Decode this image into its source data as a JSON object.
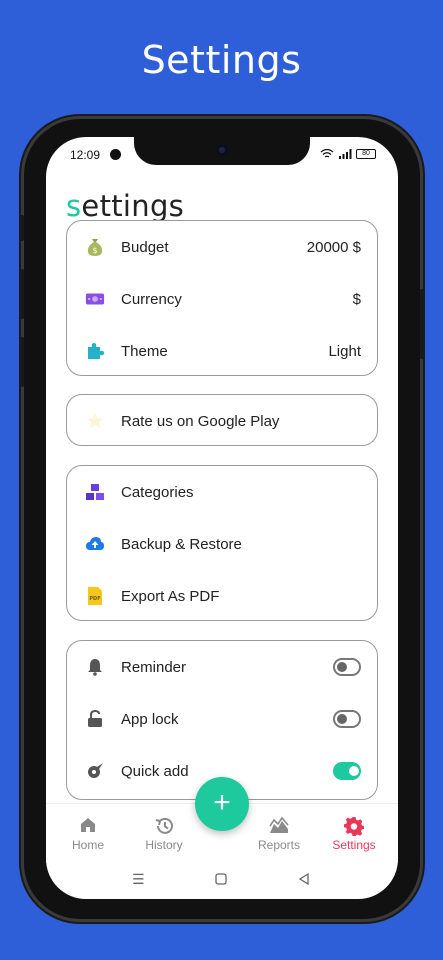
{
  "promo": {
    "title": "Settings"
  },
  "status": {
    "time": "12:09",
    "battery": "80"
  },
  "app": {
    "title_first": "s",
    "title_rest": "ettings"
  },
  "general": [
    {
      "icon": "money-bag-icon",
      "label": "Budget",
      "value": "20000 $"
    },
    {
      "icon": "banknote-icon",
      "label": "Currency",
      "value": "$"
    },
    {
      "icon": "puzzle-icon",
      "label": "Theme",
      "value": "Light"
    }
  ],
  "rate": {
    "label": "Rate us on Google Play"
  },
  "data_section": [
    {
      "icon": "cubes-icon",
      "label": "Categories"
    },
    {
      "icon": "cloud-upload-icon",
      "label": "Backup & Restore"
    },
    {
      "icon": "pdf-file-icon",
      "label": "Export As PDF"
    }
  ],
  "toggles": [
    {
      "icon": "bell-icon",
      "label": "Reminder",
      "on": false
    },
    {
      "icon": "unlock-icon",
      "label": "App lock",
      "on": false
    },
    {
      "icon": "rocket-icon",
      "label": "Quick add",
      "on": true
    }
  ],
  "nav": {
    "home": "Home",
    "history": "History",
    "reports": "Reports",
    "settings": "Settings",
    "fab": "+"
  },
  "colors": {
    "accent": "#1ec99d",
    "active": "#e8385a",
    "background": "#2f5fd8"
  }
}
